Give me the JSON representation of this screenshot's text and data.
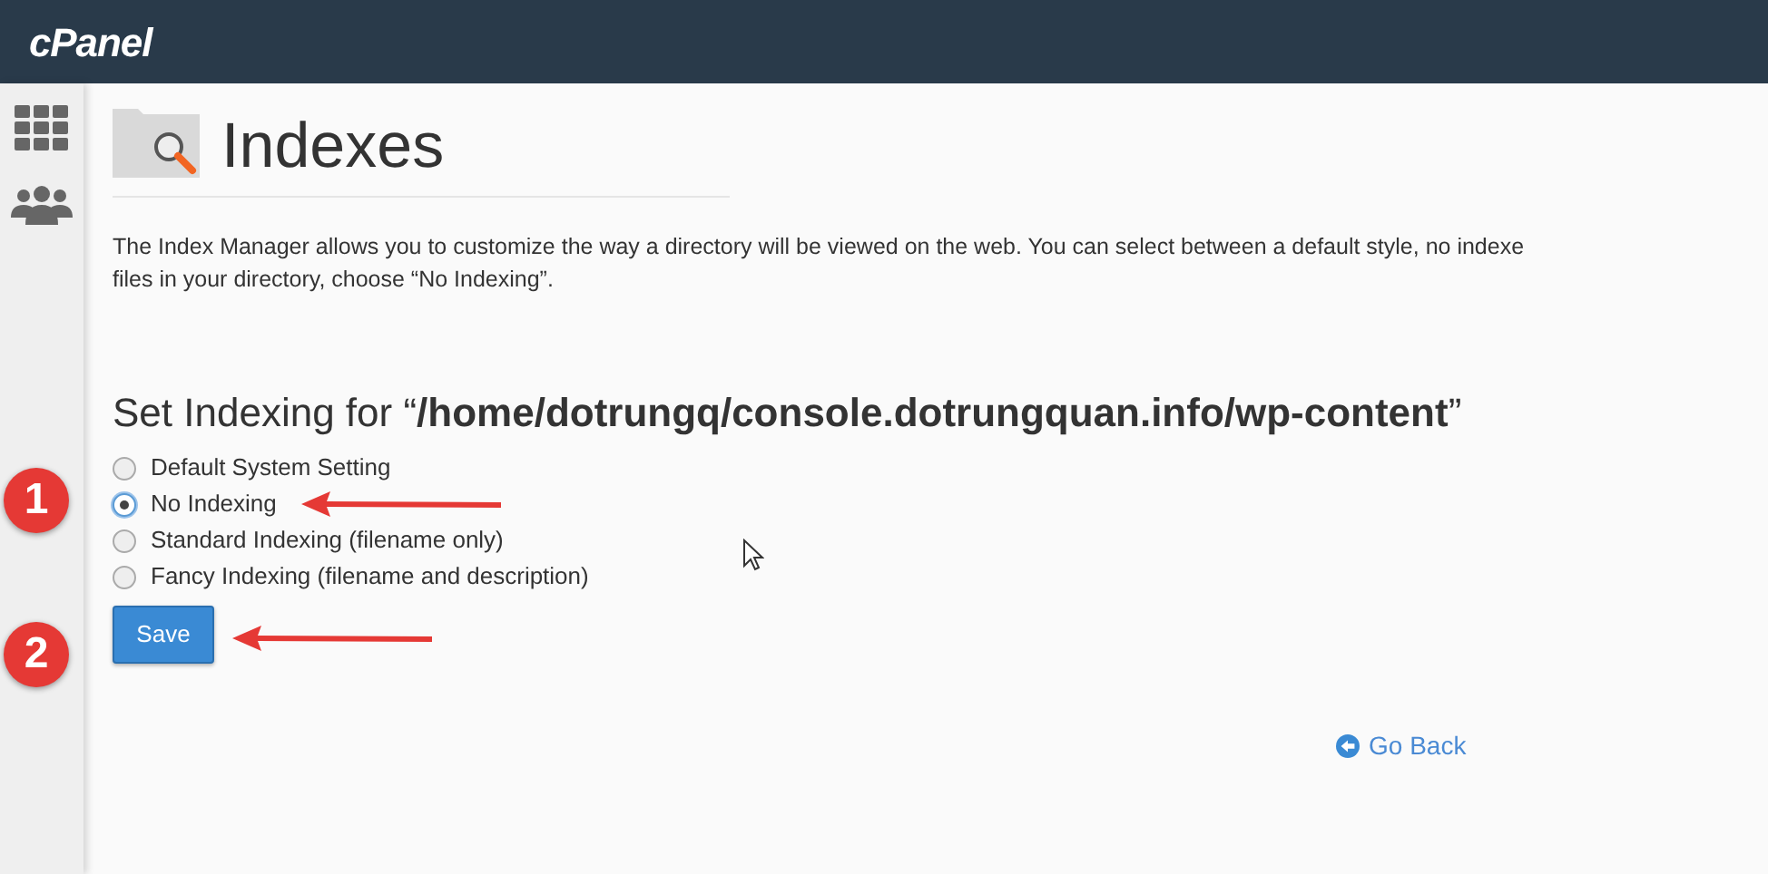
{
  "header": {
    "logo": "cPanel"
  },
  "page": {
    "title": "Indexes",
    "description": [
      "The Index Manager allows you to customize the way a directory will be viewed on the web. You can select between a default style, no indexe",
      "files in your directory, choose “No Indexing”."
    ],
    "heading": "Set Indexing for “**/home/dotrungq/console.dotrungquan.info/wp-content**”",
    "options": [
      {
        "label": "Default System Setting",
        "selected": false
      },
      {
        "label": "No Indexing",
        "selected": true
      },
      {
        "label": "Standard Indexing (filename only)",
        "selected": false
      },
      {
        "label": "Fancy Indexing (filename and description)",
        "selected": false
      }
    ],
    "save_button": "Save",
    "go_back": "Go Back"
  },
  "annotations": [
    {
      "label": "1"
    },
    {
      "label": "2"
    }
  ]
}
